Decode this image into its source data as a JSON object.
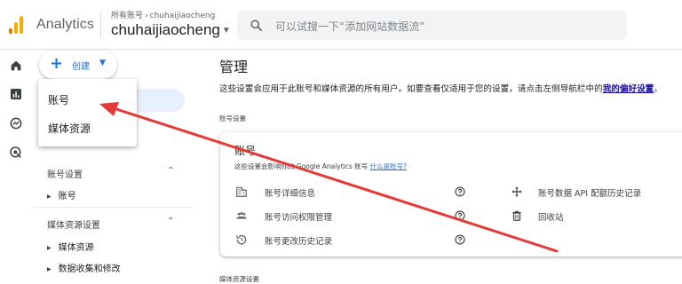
{
  "header": {
    "app_name": "Analytics",
    "account_crumb": "所有账号",
    "account_sub": "chuhaijiaocheng",
    "account_name": "chuhaijiaocheng",
    "search_placeholder": "可以试搜一下“添加网站数据流”"
  },
  "rail": {
    "icons": [
      "home-icon",
      "reports-icon",
      "explore-icon",
      "advertising-icon"
    ]
  },
  "create_button": {
    "label": "创建"
  },
  "create_menu": {
    "items": [
      {
        "label": "账号"
      },
      {
        "label": "媒体资源"
      }
    ]
  },
  "admin_nav": {
    "account_settings": {
      "title": "账号设置",
      "items": [
        "账号"
      ]
    },
    "property_settings": {
      "title": "媒体资源设置",
      "items": [
        "媒体资源",
        "数据收集和修改"
      ]
    }
  },
  "main": {
    "title": "管理",
    "description_prefix": "这些设置会应用于此账号和媒体资源的所有用户。如要查看仅适用于您的设置，请点击左侧导航栏中的",
    "description_link": "我的偏好设置",
    "description_suffix": "。",
    "account_section_label": "账号设置",
    "property_section_label": "媒体资源设置"
  },
  "account_card": {
    "title": "账号",
    "subtitle": "这些设置会影响你的 Google Analytics 账号",
    "subtitle_link": "什么是账号?",
    "rows_left": [
      {
        "label": "账号详细信息",
        "icon": "building-icon"
      },
      {
        "label": "账号访问权限管理",
        "icon": "people-icon"
      },
      {
        "label": "账号更改历史记录",
        "icon": "history-icon"
      }
    ],
    "rows_right": [
      {
        "label": "账号数据 API 配额历史记录",
        "icon": "move-icon"
      },
      {
        "label": "回收站",
        "icon": "trash-icon"
      }
    ]
  },
  "colors": {
    "accent": "#1a73e8",
    "logo_orange": "#e37400",
    "logo_yellow": "#f9ab00",
    "annotation": "#e53935",
    "nav_highlight": "#e8f0fe"
  }
}
